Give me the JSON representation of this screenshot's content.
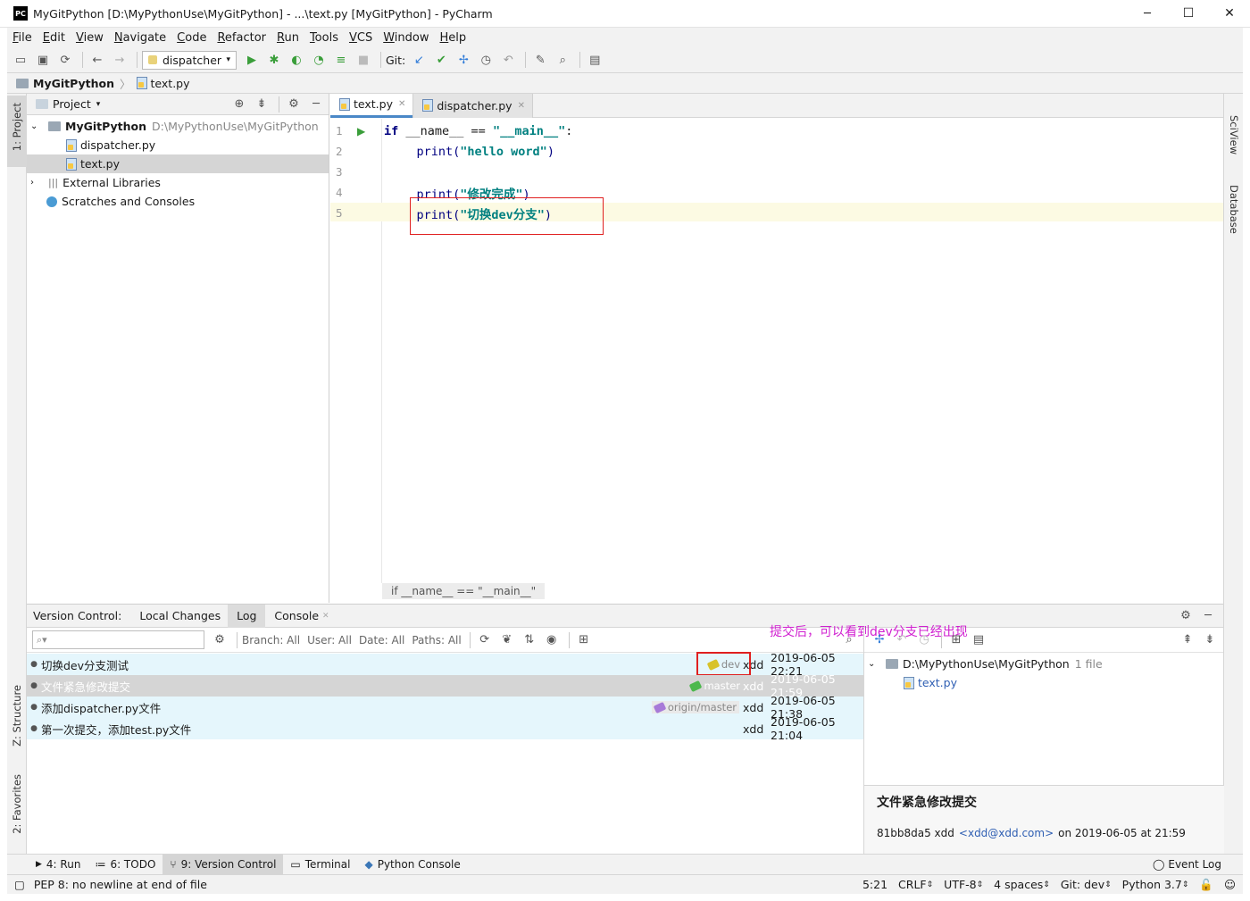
{
  "window": {
    "title": "MyGitPython [D:\\MyPythonUse\\MyGitPython] - ...\\text.py [MyGitPython] - PyCharm",
    "minimize": "─",
    "maximize": "☐",
    "close": "✕"
  },
  "menu": [
    "File",
    "Edit",
    "View",
    "Navigate",
    "Code",
    "Refactor",
    "Run",
    "Tools",
    "VCS",
    "Window",
    "Help"
  ],
  "toolbar": {
    "run_config": "dispatcher",
    "git_label": "Git:"
  },
  "breadcrumb": {
    "project": "MyGitPython",
    "file": "text.py"
  },
  "left_strip": {
    "project_tab": "1: Project",
    "structure_tab": "Z: Structure",
    "favorites_tab": "2: Favorites"
  },
  "right_strip": {
    "sciview_tab": "SciView",
    "database_tab": "Database"
  },
  "project_panel": {
    "header": "Project",
    "root_name": "MyGitPython",
    "root_path": "D:\\MyPythonUse\\MyGitPython",
    "files": [
      "dispatcher.py",
      "text.py"
    ],
    "external": "External Libraries",
    "scratches": "Scratches and Consoles"
  },
  "editor": {
    "tabs": [
      "text.py",
      "dispatcher.py"
    ],
    "line_numbers": [
      "1",
      "2",
      "3",
      "4",
      "5"
    ],
    "lines": [
      {
        "kw": "if",
        "rest": " __name__ == ",
        "str": "\"__main__\"",
        "tail": ":"
      },
      {
        "fn": "    print(",
        "str": "\"hello word\"",
        "tail": ")"
      },
      {
        "fn": "",
        "str": "",
        "tail": ""
      },
      {
        "fn": "    print(",
        "str": "\"修改完成\"",
        "tail": ")"
      },
      {
        "fn": "    print(",
        "str": "\"切换dev分支\"",
        "tail": ")"
      }
    ],
    "breadcrumb": "if __name__ == \"__main__\""
  },
  "vcs": {
    "label": "Version Control:",
    "tabs": [
      "Local Changes",
      "Log",
      "Console"
    ],
    "annotation": "提交后，可以看到dev分支已经出现",
    "filters": {
      "branch": "Branch: All",
      "user": "User: All",
      "date": "Date: All",
      "paths": "Paths: All"
    },
    "commits": [
      {
        "message": "切换dev分支测试",
        "tag": "dev",
        "author": "xdd",
        "date": "2019-06-05 22:21"
      },
      {
        "message": "文件紧急修改提交",
        "tag": "master",
        "author": "xdd",
        "date": "2019-06-05 21:59"
      },
      {
        "message": "添加dispatcher.py文件",
        "tag": "origin/master",
        "author": "xdd",
        "date": "2019-06-05 21:38"
      },
      {
        "message": "第一次提交，添加test.py文件",
        "tag": "",
        "author": "xdd",
        "date": "2019-06-05 21:04"
      }
    ],
    "changes_root": "D:\\MyPythonUse\\MyGitPython",
    "changes_count": "1 file",
    "changes_file": "text.py",
    "detail_title": "文件紧急修改提交",
    "detail_hash": "81bb8da5 xdd",
    "detail_email": "<xdd@xdd.com>",
    "detail_date": "on 2019-06-05 at 21:59"
  },
  "bottom_tabs": [
    "4: Run",
    "6: TODO",
    "9: Version Control",
    "Terminal",
    "Python Console"
  ],
  "event_log": "Event Log",
  "status": {
    "message": "PEP 8: no newline at end of file",
    "position": "5:21",
    "line_sep": "CRLF",
    "encoding": "UTF-8",
    "indent": "4 spaces",
    "git": "Git: dev",
    "interpreter": "Python 3.7"
  },
  "colors": {
    "selection": "#d5d5d5",
    "log_row": "#e5f6fc",
    "caret_line": "#fcfae3",
    "highlight_box": "#e02020",
    "annotation": "#d020d0"
  }
}
